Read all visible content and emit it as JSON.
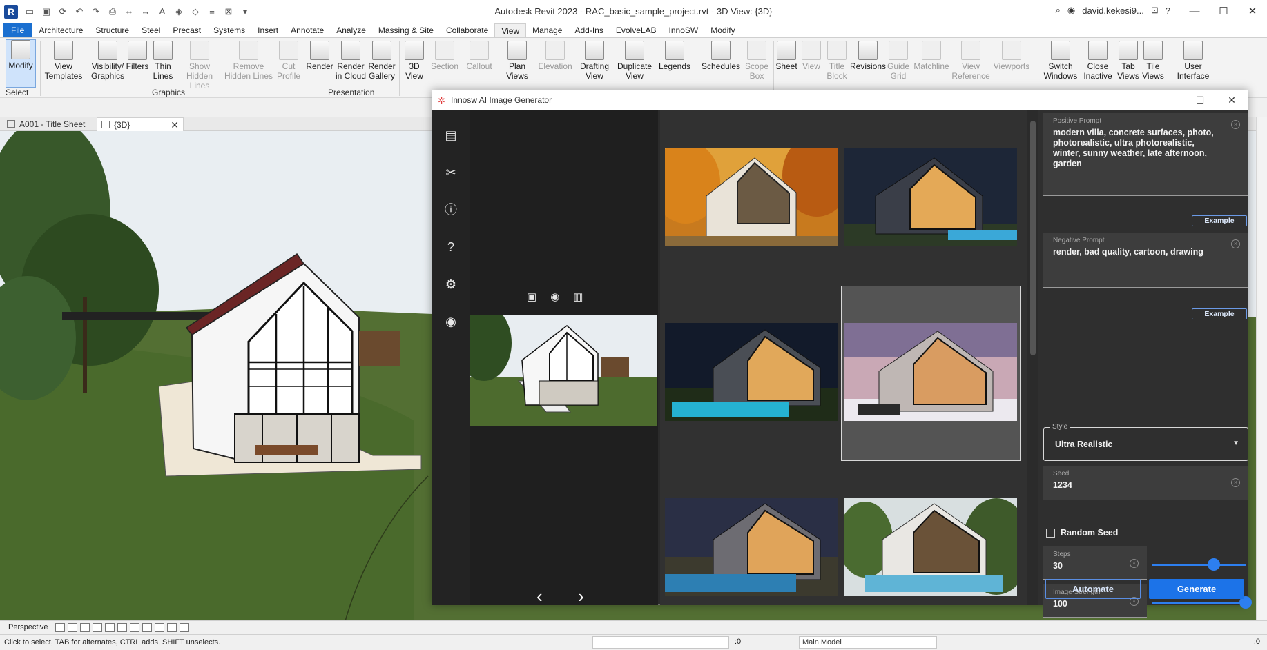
{
  "app": {
    "title": "Autodesk Revit 2023 - RAC_basic_sample_project.rvt - 3D View: {3D}",
    "logo_letter": "R",
    "user": "david.kekesi9...",
    "window_controls": [
      "—",
      "☐",
      "✕"
    ]
  },
  "quick_access": [
    "open-icon",
    "save-icon",
    "sync-icon",
    "undo-icon",
    "redo-icon",
    "print-icon",
    "measure-icon",
    "dimension-icon",
    "text-icon",
    "3d-icon",
    "section-icon",
    "switch-windows-icon",
    "close-hidden-icon",
    "customize-icon"
  ],
  "ribbon_tabs": [
    "File",
    "Architecture",
    "Structure",
    "Steel",
    "Precast",
    "Systems",
    "Insert",
    "Annotate",
    "Analyze",
    "Massing & Site",
    "Collaborate",
    "View",
    "Manage",
    "Add-Ins",
    "EvolveLAB",
    "InnoSW",
    "Modify"
  ],
  "active_tab": "View",
  "ribbon": {
    "modify": "Modify",
    "select": "Select",
    "graphics": {
      "label": "Graphics",
      "view_templates": [
        "View",
        "Templates"
      ],
      "visibility_graphics": [
        "Visibility/",
        "Graphics"
      ],
      "filters": [
        "Filters",
        ""
      ],
      "thin_lines": [
        "Thin",
        "Lines"
      ],
      "show_hidden_lines": [
        "Show",
        "Hidden Lines"
      ],
      "remove_hidden_lines": [
        "Remove",
        "Hidden Lines"
      ],
      "cut_profile": [
        "Cut",
        "Profile"
      ]
    },
    "presentation": {
      "label": "Presentation",
      "render": [
        "Render",
        ""
      ],
      "render_cloud": [
        "Render",
        "in Cloud"
      ],
      "render_gallery": [
        "Render",
        "Gallery"
      ]
    },
    "create": {
      "view3d": [
        "3D",
        "View"
      ],
      "section": [
        "Section",
        ""
      ],
      "callout": [
        "Callout",
        ""
      ],
      "plan_views": [
        "Plan",
        "Views"
      ],
      "elevation": [
        "Elevation",
        ""
      ],
      "drafting_view": [
        "Drafting",
        "View"
      ],
      "duplicate_view": [
        "Duplicate",
        "View"
      ],
      "legends": [
        "Legends",
        ""
      ],
      "schedules": [
        "Schedules",
        ""
      ],
      "scope_box": [
        "Scope",
        "Box"
      ]
    },
    "sheet": {
      "sheet": [
        "Sheet",
        ""
      ],
      "view": [
        "View",
        ""
      ],
      "title_block": [
        "Title",
        "Block"
      ],
      "revisions": [
        "Revisions",
        ""
      ],
      "guide_grid": [
        "Guide",
        "Grid"
      ],
      "matchline": [
        "Matchline",
        ""
      ],
      "view_reference": [
        "View",
        "Reference"
      ],
      "viewports": [
        "Viewports",
        ""
      ]
    },
    "windows": {
      "switch_windows": [
        "Switch",
        "Windows"
      ],
      "close_inactive": [
        "Close",
        "Inactive"
      ],
      "tab_views": [
        "Tab",
        "Views"
      ],
      "tile_views": [
        "Tile",
        "Views"
      ],
      "user_interface": [
        "User",
        "Interface"
      ]
    }
  },
  "view_tabs": [
    {
      "label": "A001 - Title Sheet"
    },
    {
      "label": "{3D}",
      "close": "✕"
    }
  ],
  "view_control": {
    "mode": "Perspective"
  },
  "status": {
    "message": "Click to select, TAB for alternates, CTRL adds, SHIFT unselects.",
    "workset_count": ":0",
    "model": "Main Model",
    "filter_count": ":0"
  },
  "dialog": {
    "title": "Innosw AI Image Generator",
    "sidebar_icons": [
      "document-icon",
      "scissors-icon",
      "info-icon",
      "help-icon",
      "settings-icon",
      "user-icon"
    ],
    "preview_tools": [
      "export-image-icon",
      "eye-icon",
      "trash-icon"
    ],
    "nav": {
      "prev": "‹",
      "next": "›"
    },
    "form": {
      "positive_prompt": {
        "label": "Positive Prompt",
        "value": "modern villa, concrete surfaces, photo, photorealistic, ultra photorealistic, winter, sunny weather, late afternoon, garden"
      },
      "example_label": "Example",
      "negative_prompt": {
        "label": "Negative Prompt",
        "value": "render, bad quality, cartoon, drawing"
      },
      "style": {
        "label": "Style",
        "value": "Ultra Realistic"
      },
      "seed": {
        "label": "Seed",
        "value": "1234"
      },
      "random_seed": {
        "label": "Random Seed",
        "checked": false
      },
      "steps": {
        "label": "Steps",
        "value": "30",
        "fraction": 0.66
      },
      "image_strength": {
        "label": "Image Strength",
        "value": "100",
        "fraction": 1.0
      },
      "automate": "Automate",
      "generate": "Generate"
    },
    "gallery": [
      {
        "name": "autumn-day"
      },
      {
        "name": "night-pool"
      },
      {
        "name": "starry-night-pool"
      },
      {
        "name": "winter-sunset",
        "selected": true
      },
      {
        "name": "dusk-pool"
      },
      {
        "name": "sunny-pool"
      }
    ]
  }
}
